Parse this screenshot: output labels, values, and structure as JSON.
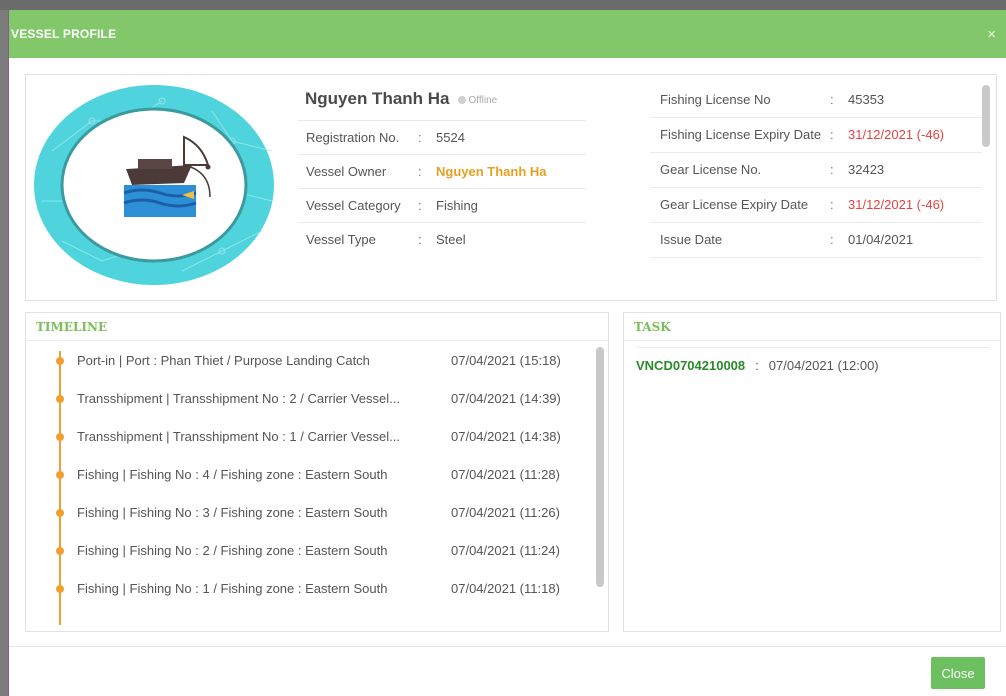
{
  "modal": {
    "title": "VESSEL PROFILE",
    "close_x": "×"
  },
  "vessel": {
    "name": "Nguyen Thanh Ha",
    "status": "Offline",
    "info": [
      {
        "label": "Registration No.",
        "value": "5524"
      },
      {
        "label": "Vessel Owner",
        "value": "Nguyen Thanh Ha"
      },
      {
        "label": "Vessel Category",
        "value": "Fishing"
      },
      {
        "label": "Vessel Type",
        "value": "Steel"
      }
    ]
  },
  "licenses": [
    {
      "label": "Fishing License No",
      "value": "45353"
    },
    {
      "label": "Fishing License Expiry Date",
      "value": "31/12/2021 (-46)"
    },
    {
      "label": "Gear License No.",
      "value": "32423"
    },
    {
      "label": "Gear License Expiry Date",
      "value": "31/12/2021 (-46)"
    },
    {
      "label": "Issue Date",
      "value": "01/04/2021"
    }
  ],
  "timeline": {
    "title": "TIMELINE",
    "items": [
      {
        "text": "Port-in | Port : Phan Thiet / Purpose Landing Catch",
        "time": "07/04/2021 (15:18)"
      },
      {
        "text": "Transshipment | Transshipment No : 2 / Carrier Vessel...",
        "time": "07/04/2021 (14:39)"
      },
      {
        "text": "Transshipment | Transshipment No : 1 / Carrier Vessel...",
        "time": "07/04/2021 (14:38)"
      },
      {
        "text": "Fishing | Fishing No : 4 / Fishing zone : Eastern South",
        "time": "07/04/2021 (11:28)"
      },
      {
        "text": "Fishing | Fishing No : 3 / Fishing zone : Eastern South",
        "time": "07/04/2021 (11:26)"
      },
      {
        "text": "Fishing | Fishing No : 2 / Fishing zone : Eastern South",
        "time": "07/04/2021 (11:24)"
      },
      {
        "text": "Fishing | Fishing No : 1 / Fishing zone : Eastern South",
        "time": "07/04/2021 (11:18)"
      }
    ]
  },
  "task": {
    "title": "TASK",
    "items": [
      {
        "id": "VNCD0704210008",
        "time": "07/04/2021 (12:00)"
      }
    ]
  },
  "footer": {
    "close_label": "Close"
  },
  "colors": {
    "header": "#82c86a",
    "accent_orange": "#f0a030",
    "danger": "#e84040",
    "task_id": "#2a8a2a"
  }
}
